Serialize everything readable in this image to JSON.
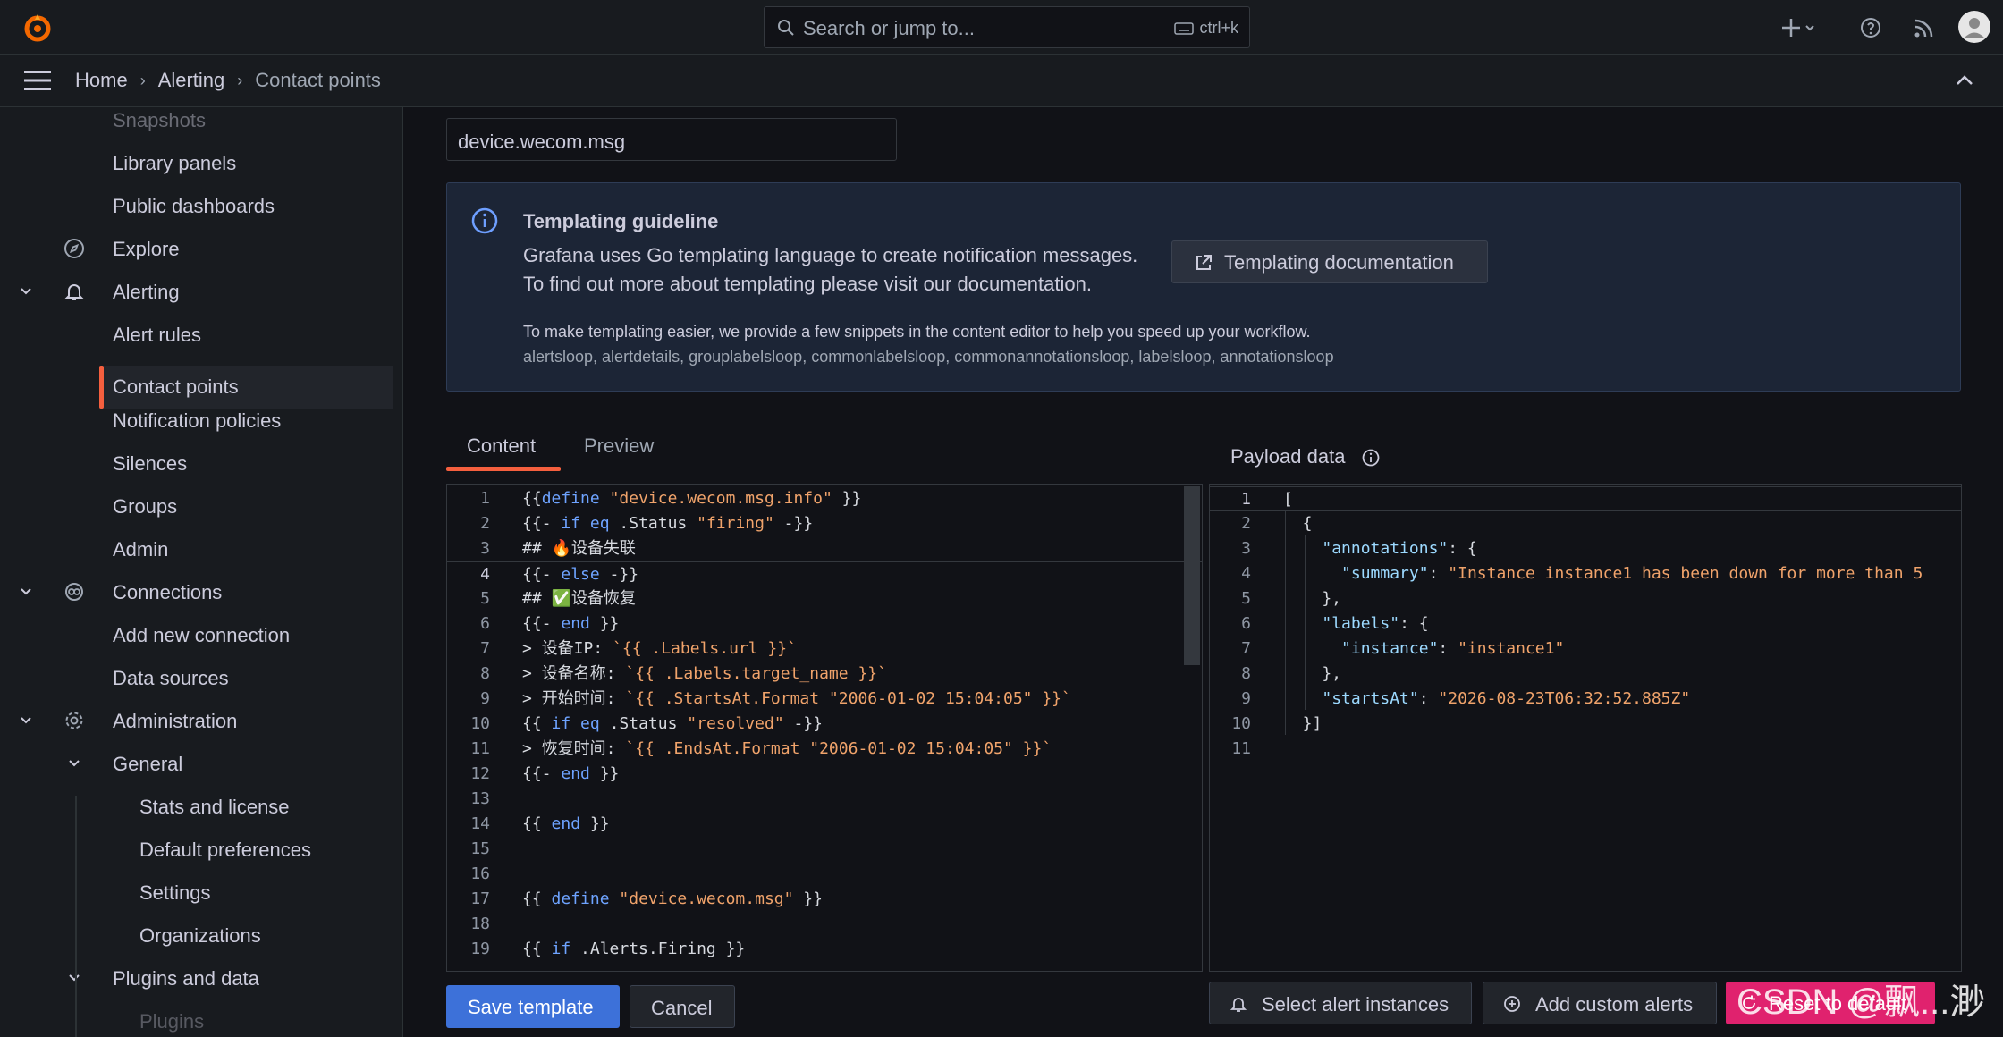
{
  "search": {
    "placeholder": "Search or jump to...",
    "shortcut": "ctrl+k"
  },
  "breadcrumb": [
    "Home",
    "Alerting",
    "Contact points"
  ],
  "sidebar": {
    "items": [
      {
        "label": "Snapshots"
      },
      {
        "label": "Library panels"
      },
      {
        "label": "Public dashboards"
      },
      {
        "label": "Explore",
        "icon": "compass-icon"
      },
      {
        "label": "Alerting",
        "icon": "bell-icon"
      },
      {
        "label": "Alert rules"
      },
      {
        "label": "Contact points",
        "active": true
      },
      {
        "label": "Notification policies"
      },
      {
        "label": "Silences"
      },
      {
        "label": "Groups"
      },
      {
        "label": "Admin"
      },
      {
        "label": "Connections",
        "icon": "connections-icon"
      },
      {
        "label": "Add new connection"
      },
      {
        "label": "Data sources"
      },
      {
        "label": "Administration",
        "icon": "cog-icon"
      },
      {
        "label": "General"
      },
      {
        "label": "Stats and license"
      },
      {
        "label": "Default preferences"
      },
      {
        "label": "Settings"
      },
      {
        "label": "Organizations"
      },
      {
        "label": "Plugins and data"
      },
      {
        "label": "Plugins"
      }
    ]
  },
  "template": {
    "name_value": "device.wecom.msg"
  },
  "guideline": {
    "title": "Templating guideline",
    "line1": "Grafana uses Go templating language to create notification messages.",
    "line2": "To find out more about templating please visit our documentation.",
    "doc_button": "Templating documentation",
    "line3": "To make templating easier, we provide a few snippets in the content editor to help you speed up your workflow.",
    "snippets": "alertsloop, alertdetails, grouplabelsloop, commonlabelsloop, commonannotationsloop, labelsloop, annotationsloop"
  },
  "tabs": {
    "content": "Content",
    "preview": "Preview"
  },
  "editor": {
    "lines": [
      "{{define \"device.wecom.msg.info\" }}",
      "{{- if eq .Status \"firing\" -}}",
      "## 🔥设备失联",
      "{{- else -}}",
      "## ✅设备恢复",
      "{{- end }}",
      "> 设备IP: `{{ .Labels.url }}`",
      "> 设备名称: `{{ .Labels.target_name }}`",
      "> 开始时间: `{{ .StartsAt.Format \"2006-01-02 15:04:05\" }}`",
      "{{ if eq .Status \"resolved\" -}}",
      "> 恢复时间: `{{ .EndsAt.Format \"2006-01-02 15:04:05\" }}`",
      "{{- end }}",
      "",
      "{{ end }}",
      "",
      "",
      "{{ define \"device.wecom.msg\" }}",
      "",
      "{{ if .Alerts.Firing }}"
    ]
  },
  "payload": {
    "title": "Payload data",
    "lines": [
      "[",
      "  {",
      "    \"annotations\": {",
      "      \"summary\": \"Instance instance1 has been down for more than 5",
      "    },",
      "    \"labels\": {",
      "      \"instance\": \"instance1\"",
      "    },",
      "    \"startsAt\": \"2026-08-23T06:32:52.885Z\"",
      "  }]",
      ""
    ]
  },
  "buttons": {
    "save": "Save template",
    "cancel": "Cancel",
    "select_instances": "Select alert instances",
    "add_custom": "Add custom alerts",
    "reset": "Reset to default"
  },
  "watermark": "CSDN @飘...渺"
}
